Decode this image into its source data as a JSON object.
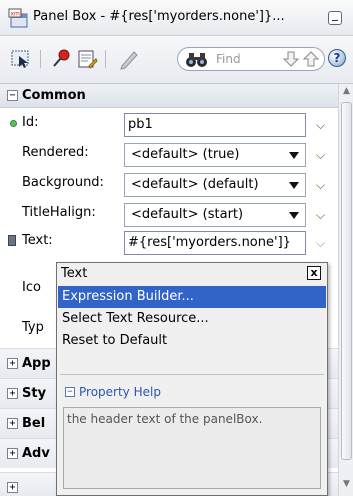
{
  "window": {
    "title": "Panel Box - #{res['myorders.none']}..."
  },
  "toolbar": {
    "find_placeholder": "Find"
  },
  "sections": {
    "common": {
      "label": "Common",
      "expander": "−",
      "properties": {
        "id": {
          "label": "Id:",
          "value": "pb1"
        },
        "rendered": {
          "label": "Rendered:",
          "value": "<default> (true)"
        },
        "background": {
          "label": "Background:",
          "value": "<default> (default)"
        },
        "title_halign": {
          "label": "TitleHalign:",
          "value": "<default> (start)"
        },
        "text": {
          "label": "Text:",
          "value": "#{res['myorders.none']}"
        },
        "icon": {
          "label": "Ico"
        },
        "type": {
          "label": "Typ"
        }
      }
    },
    "collapsed": [
      {
        "label": "App",
        "expander": "+"
      },
      {
        "label": "Sty",
        "expander": "+"
      },
      {
        "label": "Bel",
        "expander": "+"
      },
      {
        "label": "Adv",
        "expander": "+"
      },
      {
        "label": "",
        "expander": "+"
      }
    ]
  },
  "popup": {
    "title": "Text",
    "close": "x",
    "items": [
      {
        "label": "Expression Builder..."
      },
      {
        "label": "Select Text Resource..."
      },
      {
        "label": "Reset to Default"
      }
    ],
    "property_help": {
      "expander": "−",
      "title": "Property Help",
      "text": "the header text of the panelBox."
    }
  },
  "colors": {
    "menu_selection": "#3164c6",
    "help_title": "#2e55b0",
    "required_indicator": "#5fbf5f"
  }
}
